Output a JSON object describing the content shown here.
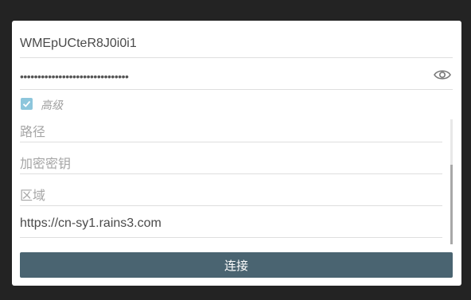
{
  "form": {
    "access_key": "WMEpUCteR8J0i0i1",
    "secret_masked": "•••••••••••••••••••••••••••••••",
    "advanced_label": "高级",
    "advanced_checked": true,
    "path_placeholder": "路径",
    "encryption_key_placeholder": "加密密钥",
    "region_placeholder": "区域",
    "endpoint": "https://cn-sy1.rains3.com",
    "connect_label": "连接"
  },
  "icons": {
    "password_toggle": "eye-icon",
    "checkbox_mark": "check-icon"
  },
  "colors": {
    "overlay": "#232323",
    "button": "#4a6471",
    "checkbox": "#8dc6dc"
  }
}
